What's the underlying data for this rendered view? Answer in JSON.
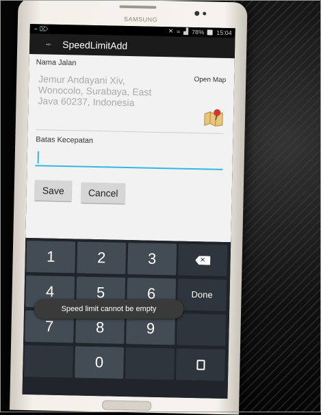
{
  "status_bar": {
    "left_icons": "⌁ ⌦",
    "battery": "78%",
    "time": "15:04"
  },
  "phone": {
    "brand": "SAMSUNG"
  },
  "app_bar": {
    "title": "SpeedLimitAdd",
    "icon": "app-speed-icon"
  },
  "form": {
    "street_label": "Nama Jalan",
    "address_lines": [
      "Jemur Andayani Xiv,",
      "Wonocolo, Surabaya, East",
      "Java 60237, Indonesia"
    ],
    "open_map_label": "Open Map",
    "speed_label": "Batas Kecepatan",
    "speed_value": "",
    "save_label": "Save",
    "cancel_label": "Cancel"
  },
  "keyboard": {
    "row1": [
      "1",
      "2",
      "3"
    ],
    "row2": [
      "4",
      "5",
      "6"
    ],
    "row3": [
      "7",
      "8",
      "9"
    ],
    "row4": [
      "0"
    ],
    "done_label": "Done",
    "backspace_icon": "backspace-icon",
    "clipboard_icon": "clipboard-icon"
  },
  "toast": {
    "message": "Speed limit cannot be empty"
  },
  "colors": {
    "accent": "#33b5e5",
    "keyboard_bg": "#20252b",
    "key_bg": "#434b54",
    "content_bg": "#f2f2f2"
  }
}
